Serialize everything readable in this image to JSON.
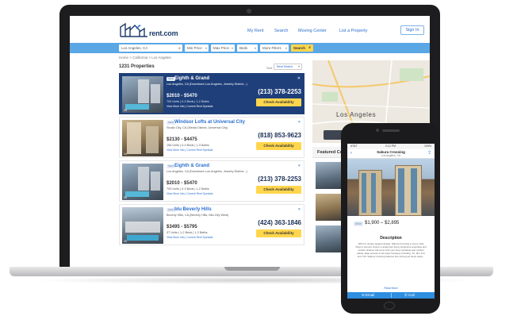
{
  "site": {
    "logo_text": "rent.com",
    "nav": [
      "My Rent",
      "Search",
      "Moving Center",
      "List a Property"
    ],
    "signin_label": "Sign In"
  },
  "search": {
    "location_value": "Los Angeles, CA",
    "min_price": "Min Price",
    "max_price": "Max Price",
    "beds": "Beds",
    "more_filters": "More Filters",
    "search_button": "Search"
  },
  "breadcrumb": "Home > California > Los Angeles",
  "results": {
    "count_label": "1231 Properties",
    "sort_label": "Sort",
    "sort_value": "Best Match"
  },
  "listings": [
    {
      "badge": "NEW",
      "name": "Eighth & Grand",
      "address": "Los Angeles, CA (Downtown Los Angeles, Jewelry District...)",
      "price": "$2010 - $5470",
      "units": "700 Units | 0-3 Beds | 1-2 Baths",
      "links": "View More Info | Current Rent Specials",
      "phone": "(213) 378-2253",
      "cta": "Check Availability",
      "photo_count": "25"
    },
    {
      "badge": "NEW",
      "name": "Windsor Lofts at Universal City",
      "address": "Studio City, CA (Media District, Universal City)",
      "price": "$2130 - $4475",
      "units": "156 Units | 0-3 Beds | 1-3 Baths",
      "links": "View More Info | Current Rent Specials",
      "phone": "(818) 853-9623",
      "cta": "Check Availability",
      "photo_count": "14"
    },
    {
      "badge": "NEW",
      "name": "Eighth & Grand",
      "address": "Los Angeles, CA (Downtown Los Angeles, Jewelry District...)",
      "price": "$2010 - $5470",
      "units": "700 Units | 0-3 Beds | 1-2 Baths",
      "links": "View More Info | Current Rent Specials",
      "phone": "(213) 378-2253",
      "cta": "Check Availability",
      "photo_count": "25"
    },
    {
      "badge": "NEW",
      "name": "blu Beverly Hills",
      "address": "Beverly Hills, CA (Beverly Hills, Mid-City West)",
      "price": "$3495 - $5795",
      "units": "37 Units | 1-2 Beds | 1-2 Baths",
      "links": "View More Info | Current Rent Specials",
      "phone": "(424) 363-1846",
      "cta": "Check Availability",
      "photo_count": "20"
    }
  ],
  "map": {
    "city_label": "Los Angeles",
    "view_button": "Go to map view"
  },
  "featured": {
    "heading": "Featured Com"
  },
  "phone": {
    "carrier": "AT&T",
    "time": "2:12 PM",
    "battery": "100%",
    "title": "Sakura Crossing",
    "subtitle": "Los Angeles, CA",
    "badge": "NEW",
    "price": "$1,900 – $2,895",
    "description_heading": "Description",
    "description": "With it's unique elegant design, Sakura Crossing is every Little Tokyo's premier choice in apartment living. Extensive amenities and modern finishes will come with your busy schedule and modern palate. Easy access to all major freeways including, 10, 110, 101 and 710. Sakura Crossing features fine dining just steps away...",
    "read_more": "Read More",
    "email_label": "Email",
    "call_label": "Call"
  },
  "colors": {
    "accent_blue": "#2b6fcf",
    "search_bar": "#5aa7e6",
    "cta_yellow": "#ffd64d",
    "featured_navy": "#1e3f7a"
  }
}
